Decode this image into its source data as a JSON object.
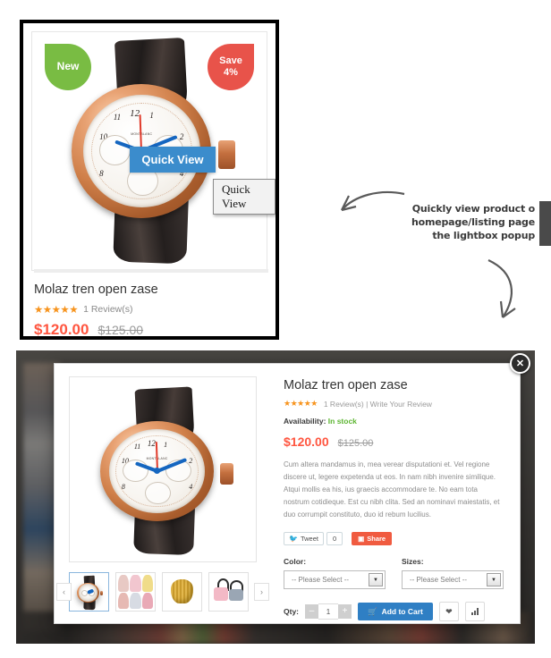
{
  "product_card": {
    "badge_new": "New",
    "badge_save_line1": "Save",
    "badge_save_line2": "4%",
    "quick_view_button": "Quick View",
    "quick_view_tooltip": "Quick View",
    "title": "Molaz tren open zase",
    "stars": "★★★★★",
    "reviews": "1 Review(s)",
    "price_now": "$120.00",
    "price_old": "$125.00",
    "watch_brand": "MONTBLANC"
  },
  "annotation": {
    "line1": "Quickly view product o",
    "line2": "homepage/listing page",
    "line3": "the lightbox popup"
  },
  "lightbox": {
    "close_label": "✕",
    "title": "Molaz tren open zase",
    "stars": "★★★★★",
    "reviews": "1 Review(s)  |  Write Your Review",
    "availability_label": "Availability:",
    "availability_value": "In stock",
    "price_now": "$120.00",
    "price_old": "$125.00",
    "description": "Cum altera mandamus in, mea verear disputationi et. Vel regione discere ut, legere expetenda ut eos. In nam nibh invenire similique. Atqui mollis ea his, ius graecis accommodare te. No eam tota nostrum cotidieque. Est cu nibh clita. Sed an nominavi maiestatis, et duo corrumpit constituto, duo id rebum lucilius.",
    "social": {
      "tweet_label": "Tweet",
      "tweet_count": "0",
      "share_label": "Share"
    },
    "options": [
      {
        "label": "Color:",
        "value": "-- Please Select --"
      },
      {
        "label": "Sizes:",
        "value": "-- Please Select --"
      }
    ],
    "qty_label": "Qty:",
    "qty_minus": "–",
    "qty_value": "1",
    "qty_plus": "+",
    "add_to_cart": "Add to Cart",
    "thumb_prev": "‹",
    "thumb_next": "›"
  },
  "colors": {
    "accent_blue": "#2f7fc4",
    "price_red": "#ff5640",
    "badge_green": "#79bc43",
    "badge_red": "#e8534a",
    "stock_green": "#5cb531",
    "star_orange": "#f7941e",
    "share_red": "#f05b40"
  }
}
